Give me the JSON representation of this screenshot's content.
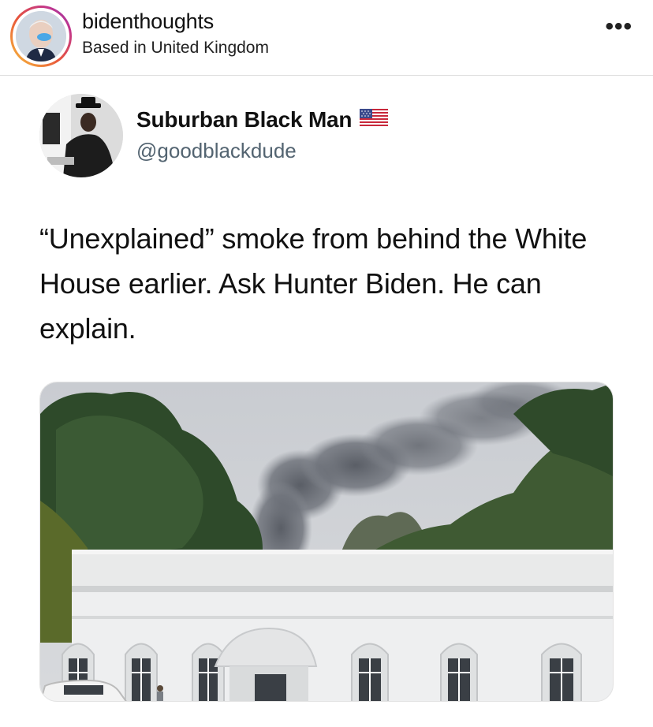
{
  "post_header": {
    "username": "bidenthoughts",
    "location": "Based in United Kingdom",
    "more_icon": "more-horizontal-icon",
    "more_glyph": "•••"
  },
  "tweet": {
    "author_name": "Suburban Black Man",
    "author_handle": "@goodblackdude",
    "flag_icon": "us-flag-icon",
    "text": "“Unexplained” smoke from behind the White House earlier. Ask Hunter Biden. He can explain.",
    "media": {
      "kind": "photo",
      "subject": "white-building-with-smoke"
    }
  },
  "colors": {
    "handle_gray": "#536471",
    "divider": "#dcdcdc"
  }
}
